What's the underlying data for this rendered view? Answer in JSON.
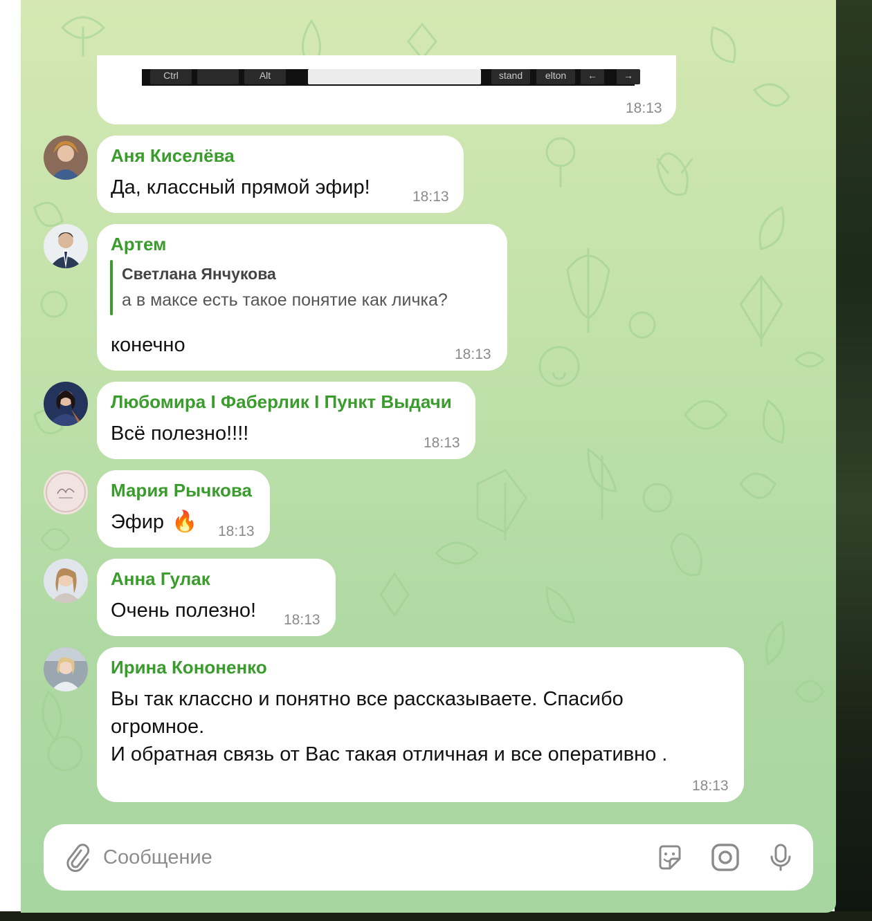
{
  "chat": {
    "top_card": {
      "time": "18:13",
      "keyboard_keys": [
        "Ctrl",
        "",
        "Alt",
        "",
        "stand",
        "elton",
        "←",
        "→"
      ]
    },
    "messages": [
      {
        "sender": "Аня Киселёва",
        "text": "Да, классный прямой эфир!",
        "time": "18:13"
      },
      {
        "sender": "Артем",
        "reply": {
          "name": "Светлана Янчукова",
          "text": "а в максе есть такое понятие как личка?"
        },
        "text": "конечно",
        "time": "18:13"
      },
      {
        "sender": "Любомира I Фаберлик I Пункт Выдачи",
        "text": "Всё полезно!!!!",
        "time": "18:13"
      },
      {
        "sender": "Мария Рычкова",
        "text": "Эфир",
        "emoji": "🔥",
        "time": "18:13"
      },
      {
        "sender": "Анна Гулак",
        "text": "Очень полезно!",
        "time": "18:13"
      },
      {
        "sender": "Ирина Кононенко",
        "lines": [
          "Вы так классно и понятно все рассказываете. Спасибо",
          "огромное.",
          "И обратная связь от Вас такая отличная и все оперативно ."
        ],
        "time": "18:13"
      }
    ]
  },
  "composer": {
    "placeholder": "Сообщение",
    "value": ""
  },
  "icons": {
    "attach": "paperclip-icon",
    "sticker": "sticker-icon",
    "camera": "camera-icon",
    "voice": "microphone-icon"
  },
  "colors": {
    "sender_name": "#3a9c2c",
    "bubble": "#ffffff",
    "time": "#8a8a8a",
    "background_top": "#d5e8b3",
    "background_bottom": "#a7d6a0"
  }
}
